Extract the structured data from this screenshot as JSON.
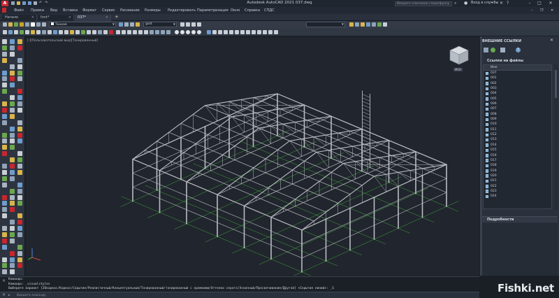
{
  "app": {
    "title": "Autodesk AutoCAD 2021    037.dwg",
    "logo_letter": "A",
    "search_placeholder": "Введите ключевое слово/фразу",
    "sign_in": "Вход в службы"
  },
  "menu": [
    "Файл",
    "Правка",
    "Вид",
    "Вставка",
    "Формат",
    "Сервис",
    "Рисование",
    "Размеры",
    "Редактировать",
    "Параметризация",
    "Окно",
    "Справка",
    "СПДС"
  ],
  "tabs": [
    {
      "label": "Начало",
      "active": false
    },
    {
      "label": "font*",
      "active": false
    },
    {
      "label": "037*",
      "active": true
    }
  ],
  "toolbar": {
    "layer_combo": "Тонкая",
    "style_combo": "gost"
  },
  "viewport": {
    "label": "[-][Пользовательский вид][Тонированный]",
    "cube_top": "Сверху",
    "wcs": "МСК"
  },
  "xref_panel": {
    "header": "ВНЕШНИЕ ССЫЛКИ",
    "refs_title": "Ссылки на файлы",
    "column": "Имя",
    "files": [
      "037",
      "001",
      "002",
      "003",
      "004",
      "005",
      "006",
      "007",
      "008",
      "009",
      "010",
      "011",
      "012",
      "013",
      "014",
      "015",
      "016",
      "017",
      "018",
      "019",
      "020",
      "021",
      "022",
      "023",
      "024"
    ],
    "details_title": "Подробности"
  },
  "command": {
    "lines": [
      "Команда:",
      "Команда: _visualstyles",
      "Выберите вариант [2Dкаркас/Каркас/Скрытие/Реалистичный/Концептуальный/Тонированный/тонированный с кромками/Оттенки серого/Эскизный/Просвечивание/Другой] <Скрытие линий>: _S"
    ],
    "placeholder": "Введите команду"
  },
  "watermark": "Fishki.net",
  "colors": {
    "frame": "#1e2228",
    "viewport_bg": "#21252d",
    "steel": "#b9bdc2",
    "grid_green": "#3fa83f",
    "logo_red": "#c8262e"
  }
}
